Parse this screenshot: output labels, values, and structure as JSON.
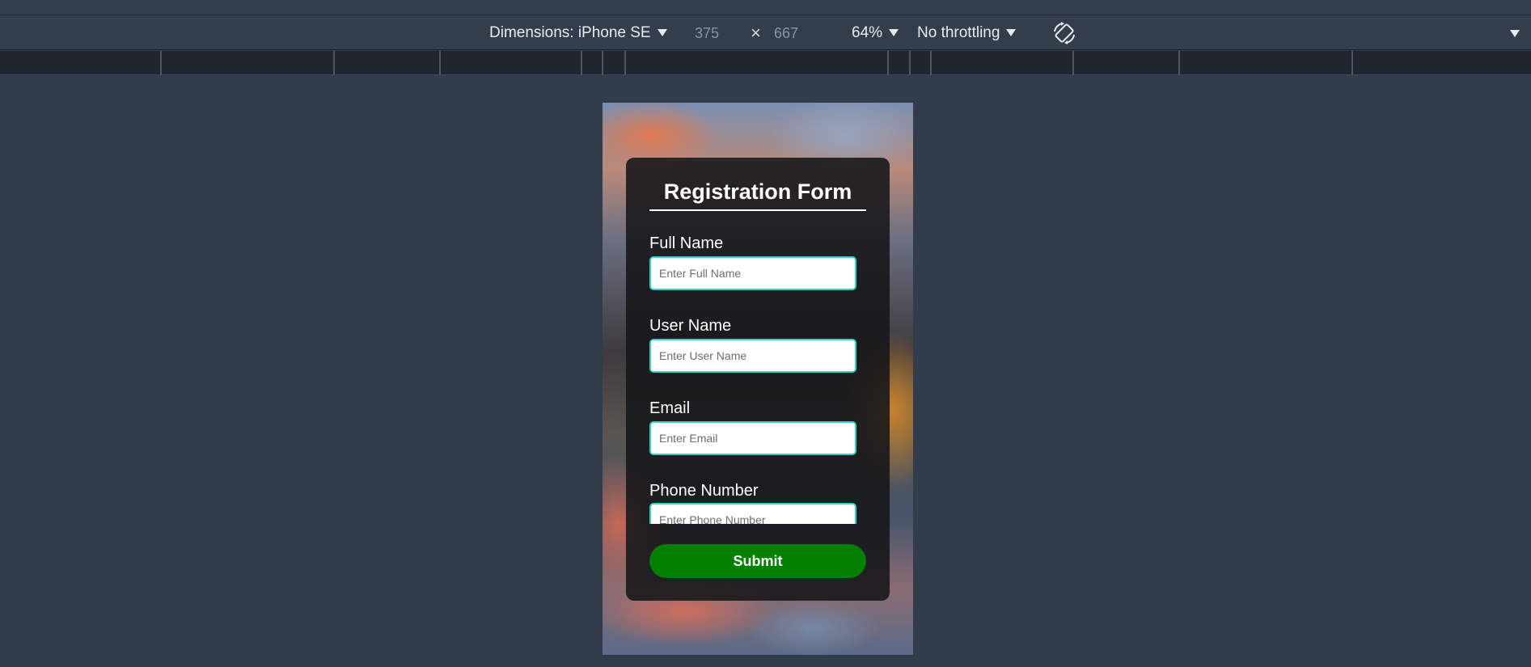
{
  "devtools": {
    "dimensions_label": "Dimensions: iPhone SE",
    "width_value": "375",
    "height_value": "667",
    "times_symbol": "×",
    "zoom": "64%",
    "throttling": "No throttling"
  },
  "form": {
    "title": "Registration Form",
    "fields": [
      {
        "label": "Full Name",
        "placeholder": "Enter Full Name"
      },
      {
        "label": "User Name",
        "placeholder": "Enter User Name"
      },
      {
        "label": "Email",
        "placeholder": "Enter Email"
      },
      {
        "label": "Phone Number",
        "placeholder": "Enter Phone Number"
      }
    ],
    "submit_label": "Submit"
  },
  "icons": {
    "dimensions_dropdown": "caret-down-icon",
    "zoom_dropdown": "caret-down-icon",
    "throttling_dropdown": "caret-down-icon",
    "rotate": "rotate-icon",
    "more_options": "caret-down-icon"
  },
  "colors": {
    "toolbar_bg": "#343d4c",
    "page_bg": "#333c4b",
    "input_border": "#2fd3c3",
    "submit_bg": "#028002"
  }
}
